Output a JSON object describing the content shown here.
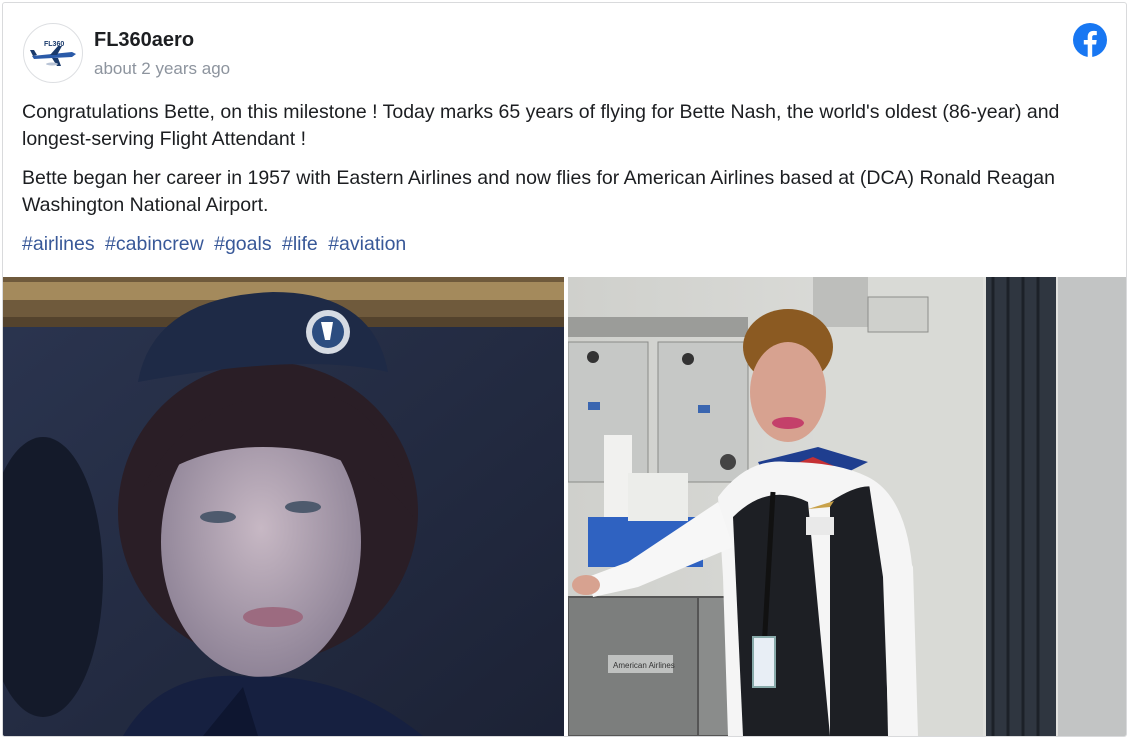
{
  "post": {
    "author": "FL360aero",
    "timestamp": "about 2 years ago",
    "avatar": {
      "logo_text": "FL360",
      "icon": "airplane-icon"
    },
    "platform_icon": "facebook-icon",
    "paragraphs": [
      "Congratulations Bette, on this milestone ! Today marks 65 years of flying for Bette Nash, the world's oldest (86-year) and longest-serving Flight Attendant !",
      "Bette began her career in 1957 with Eastern Airlines and now flies for American Airlines based at (DCA) Ronald Reagan Washington National Airport."
    ],
    "hashtags": [
      "#airlines",
      "#cabincrew",
      "#goals",
      "#life",
      "#aviation"
    ],
    "photos": [
      {
        "name": "vintage-portrait-photo"
      },
      {
        "name": "galley-portrait-photo",
        "cart_label": "American Airlines"
      }
    ],
    "colors": {
      "facebook_blue": "#1877f2",
      "hashtag_blue": "#385898",
      "meta_gray": "#8d949e"
    }
  }
}
